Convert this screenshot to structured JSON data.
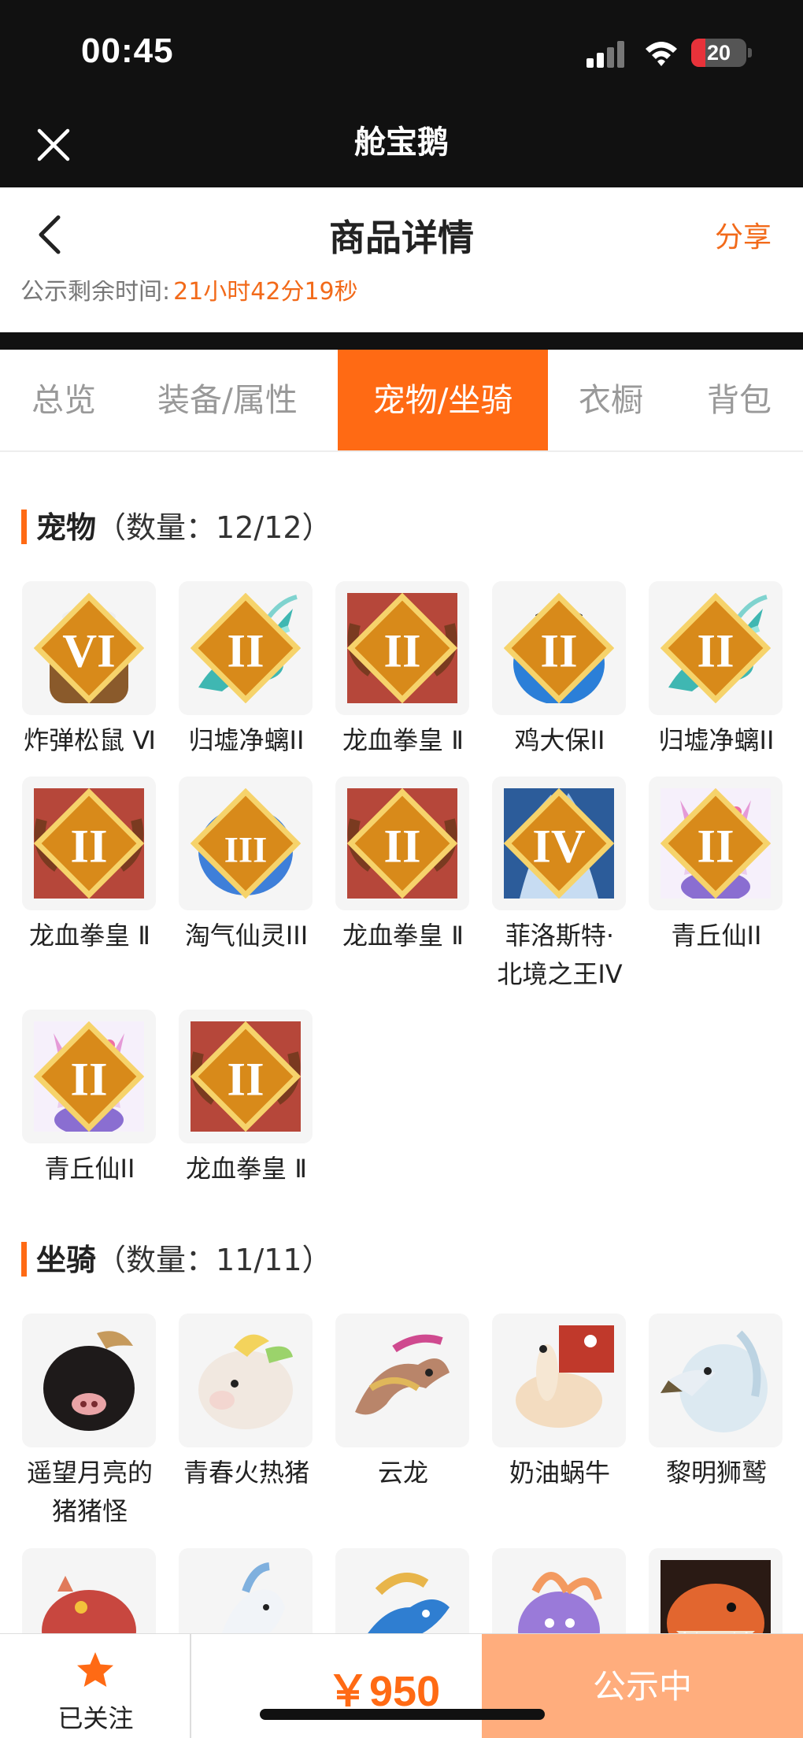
{
  "status_bar": {
    "time": "00:45",
    "battery": "20"
  },
  "mini_program": {
    "title": "舱宝鹅"
  },
  "nav": {
    "title": "商品详情",
    "share": "分享"
  },
  "countdown": {
    "label": "公示剩余时间:",
    "value": "21小时42分19秒"
  },
  "tabs": [
    {
      "label": "总览",
      "active": false
    },
    {
      "label": "装备/属性",
      "active": false
    },
    {
      "label": "宠物/坐骑",
      "active": true
    },
    {
      "label": "衣橱",
      "active": false
    },
    {
      "label": "背包",
      "active": false
    }
  ],
  "pets": {
    "title": "宠物",
    "count": "（数量：12/12）",
    "items": [
      {
        "name": "炸弹松鼠 Ⅵ",
        "rank": "VI",
        "icon": "squirrel-icon"
      },
      {
        "name": "归墟净螭II",
        "rank": "II",
        "icon": "teal-dragon-icon"
      },
      {
        "name": "龙血拳皇 Ⅱ",
        "rank": "II",
        "icon": "dragon-boxer-icon"
      },
      {
        "name": "鸡大保II",
        "rank": "II",
        "icon": "blue-bird-icon"
      },
      {
        "name": "归墟净螭II",
        "rank": "II",
        "icon": "teal-dragon-icon"
      },
      {
        "name": "龙血拳皇 Ⅱ",
        "rank": "II",
        "icon": "dragon-boxer-icon"
      },
      {
        "name": "淘气仙灵III",
        "rank": "III",
        "icon": "blue-dog-icon"
      },
      {
        "name": "龙血拳皇 Ⅱ",
        "rank": "II",
        "icon": "dragon-boxer-icon"
      },
      {
        "name": "菲洛斯特·北境之王IV",
        "name_lines": [
          "菲洛斯特·",
          "北境之王IV"
        ],
        "rank": "IV",
        "icon": "ice-king-icon"
      },
      {
        "name": "青丘仙II",
        "rank": "II",
        "icon": "fox-fairy-icon"
      },
      {
        "name": "青丘仙II",
        "rank": "II",
        "icon": "fox-fairy-icon"
      },
      {
        "name": "龙血拳皇 Ⅱ",
        "rank": "II",
        "icon": "dragon-boxer-icon"
      }
    ]
  },
  "mounts": {
    "title": "坐骑",
    "count": "（数量：11/11）",
    "items": [
      {
        "name": "遥望月亮的猪猪怪",
        "name_lines": [
          "遥望月亮的",
          "猪猪怪"
        ],
        "icon": "black-pig-icon"
      },
      {
        "name": "青春火热猪",
        "icon": "white-pig-icon"
      },
      {
        "name": "云龙",
        "icon": "cloud-dragon-icon"
      },
      {
        "name": "奶油蜗牛",
        "icon": "snail-icon"
      },
      {
        "name": "黎明狮鹫",
        "icon": "griffin-icon"
      },
      {
        "name": "",
        "icon": "red-lizard-icon"
      },
      {
        "name": "",
        "icon": "white-horse-icon"
      },
      {
        "name": "",
        "icon": "blue-dragon-icon"
      },
      {
        "name": "",
        "icon": "purple-beast-icon"
      },
      {
        "name": "",
        "icon": "orange-shark-icon"
      }
    ]
  },
  "bottom_bar": {
    "follow": "已关注",
    "price": "￥950",
    "status": "公示中"
  },
  "colors": {
    "accent": "#ff6a14",
    "publish_bg": "#ffad7d",
    "dark": "#111111"
  }
}
